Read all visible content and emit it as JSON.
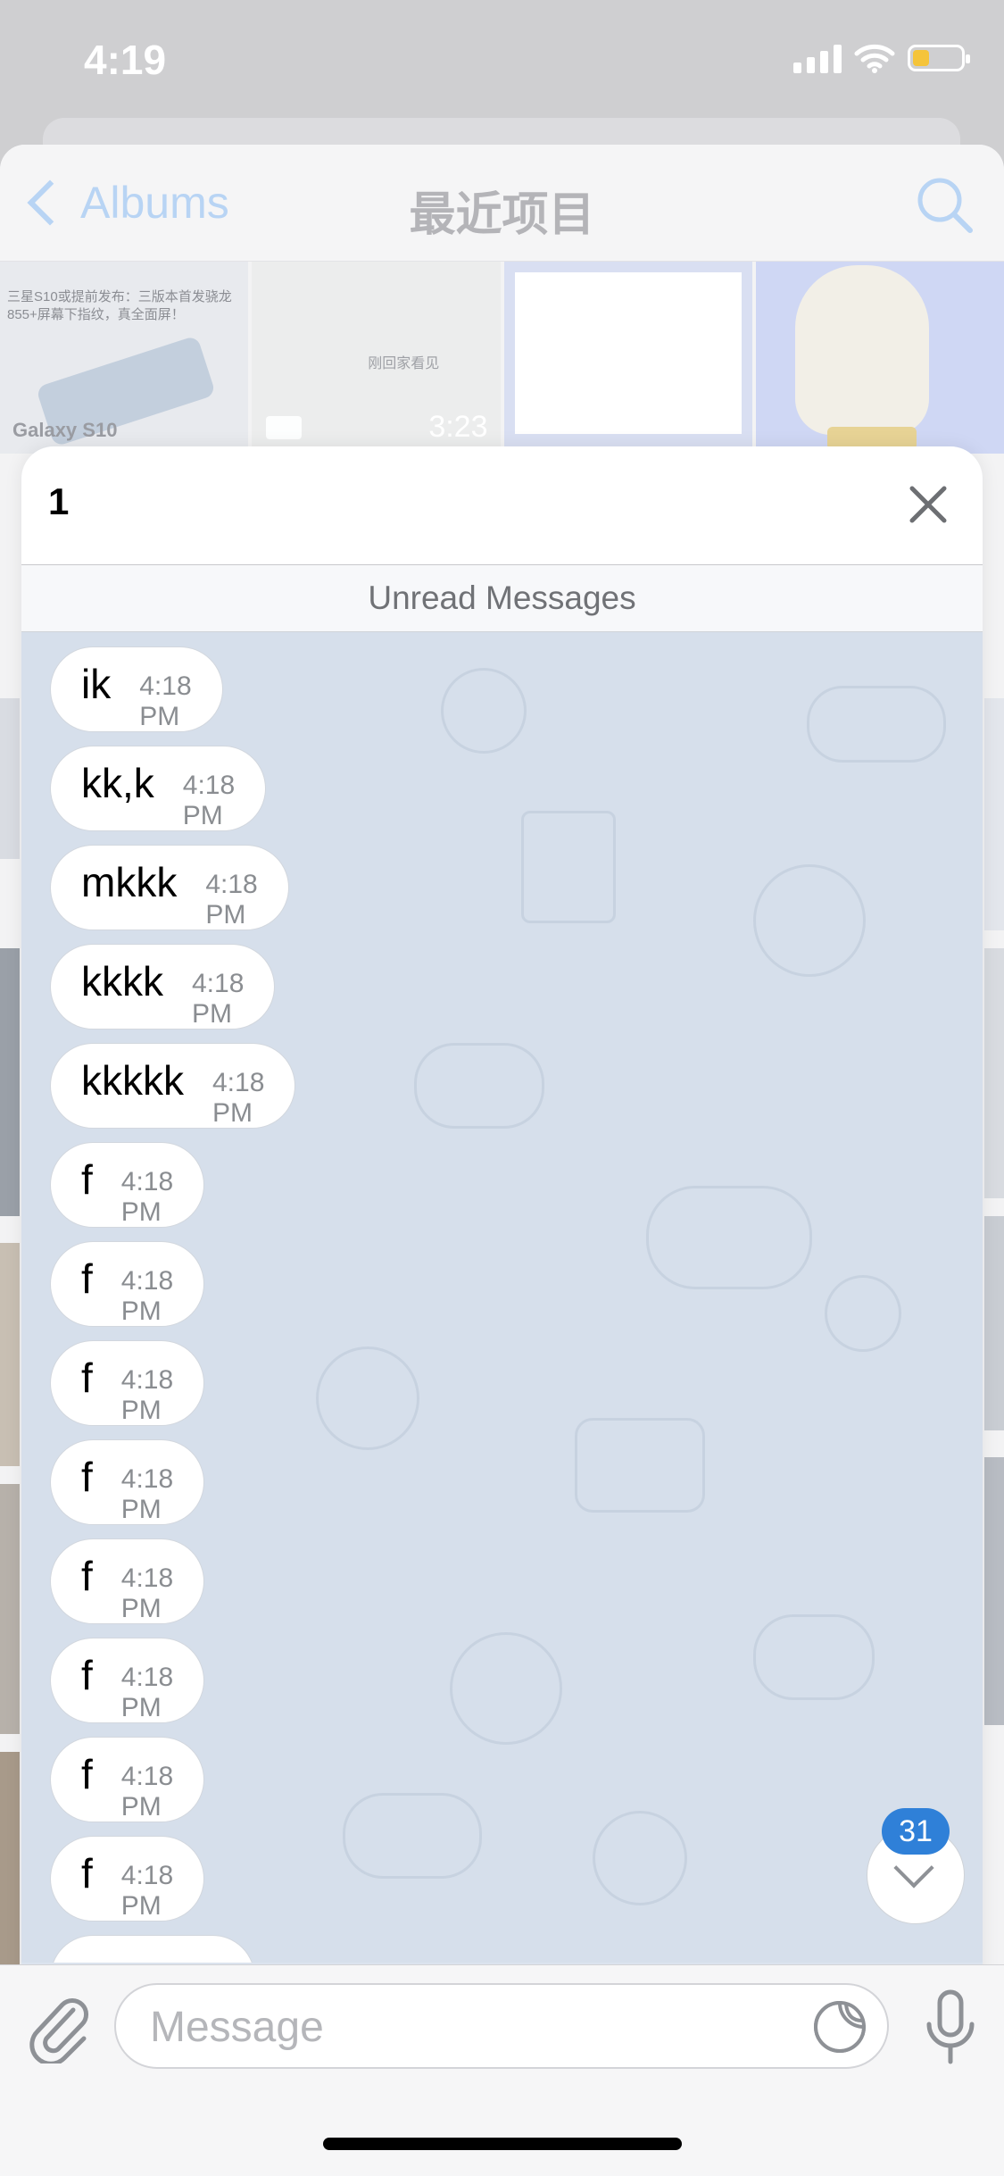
{
  "status_bar": {
    "time": "4:19"
  },
  "albums": {
    "back_label": "Albums",
    "title": "最近项目",
    "thumb1_caption": "三星S10或提前发布：三版本首发骁龙855+屏幕下指纹，真全面屏！",
    "thumb1_brand": "Galaxy S10",
    "thumb2_duration": "3:23",
    "thumb2_text": "刚回家看见"
  },
  "chat": {
    "title": "1",
    "unread_label": "Unread Messages",
    "messages": [
      {
        "text": "ik",
        "time": "4:18 PM"
      },
      {
        "text": "kk,k",
        "time": "4:18 PM"
      },
      {
        "text": "mkkk",
        "time": "4:18 PM"
      },
      {
        "text": "kkkk",
        "time": "4:18 PM"
      },
      {
        "text": "kkkkk",
        "time": "4:18 PM"
      },
      {
        "text": "f",
        "time": "4:18 PM"
      },
      {
        "text": "f",
        "time": "4:18 PM"
      },
      {
        "text": "f",
        "time": "4:18 PM"
      },
      {
        "text": "f",
        "time": "4:18 PM"
      },
      {
        "text": "f",
        "time": "4:18 PM"
      },
      {
        "text": "f",
        "time": "4:18 PM"
      },
      {
        "text": "f",
        "time": "4:18 PM"
      },
      {
        "text": "f",
        "time": "4:18 PM"
      }
    ],
    "unread_count": "31"
  },
  "input": {
    "placeholder": "Message"
  },
  "colors": {
    "accent": "#2f80d8",
    "chat_bg": "#d6dfeb",
    "bubble": "#ffffff"
  },
  "icons": [
    "close-icon",
    "search-icon",
    "attach-icon",
    "sticker-icon",
    "mic-icon",
    "chevron-down-icon",
    "back-chevron-icon"
  ]
}
